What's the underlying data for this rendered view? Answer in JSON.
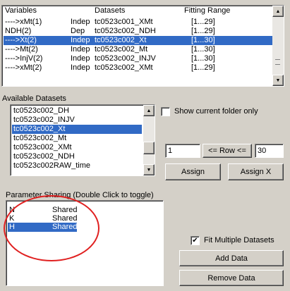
{
  "variables_table": {
    "headers": {
      "variables": "Variables",
      "datasets": "Datasets",
      "fitting_range": "Fitting Range"
    },
    "rows": [
      {
        "name": "---->xMt(1)",
        "type": "Indep",
        "dataset": "tc0523c001_XMt",
        "range": "[1...29]",
        "selected": false
      },
      {
        "name": "NDH(2)",
        "type": "Dep",
        "dataset": "tc0523c002_NDH",
        "range": "[1...29]",
        "selected": false
      },
      {
        "name": "---->Xt(2)",
        "type": "Indep",
        "dataset": "tc0523c002_Xt",
        "range": "[1...30]",
        "selected": true
      },
      {
        "name": "---->Mt(2)",
        "type": "Indep",
        "dataset": "tc0523c002_Mt",
        "range": "[1...30]",
        "selected": false
      },
      {
        "name": "---->InjV(2)",
        "type": "Indep",
        "dataset": "tc0523c002_INJV",
        "range": "[1...30]",
        "selected": false
      },
      {
        "name": "---->xMt(2)",
        "type": "Indep",
        "dataset": "tc0523c002_XMt",
        "range": "[1...29]",
        "selected": false
      }
    ]
  },
  "available_datasets": {
    "label": "Available Datasets",
    "items": [
      {
        "text": "tc0523c002_DH",
        "selected": false
      },
      {
        "text": "tc0523c002_INJV",
        "selected": false
      },
      {
        "text": "tc0523c002_Xt",
        "selected": true
      },
      {
        "text": "tc0523c002_Mt",
        "selected": false
      },
      {
        "text": "tc0523c002_XMt",
        "selected": false
      },
      {
        "text": "tc0523c002_NDH",
        "selected": false
      },
      {
        "text": "tc0523c002RAW_time",
        "selected": false
      }
    ]
  },
  "show_current_folder": {
    "label": "Show current folder only",
    "checked": false
  },
  "row_range": {
    "start": "1",
    "end": "30",
    "button_label": "<= Row <="
  },
  "assign_label": "Assign",
  "assign_x_label": "Assign X",
  "parameter_sharing": {
    "label": "Parameter Sharing (Double Click to toggle)",
    "rows": [
      {
        "param": "N",
        "state": "Shared",
        "selected": false
      },
      {
        "param": "K",
        "state": "Shared",
        "selected": false
      },
      {
        "param": "H",
        "state": "Shared",
        "selected": true
      }
    ]
  },
  "fit_multiple": {
    "label": "Fit Multiple Datasets",
    "checked": true,
    "mark": "✔"
  },
  "add_data_label": "Add Data",
  "remove_data_label": "Remove Data",
  "colors": {
    "selection": "#316ac5",
    "annotation": "#e02020",
    "face": "#d4d0c8"
  },
  "icons": {
    "scroll_up": "▲",
    "scroll_down": "▼"
  }
}
